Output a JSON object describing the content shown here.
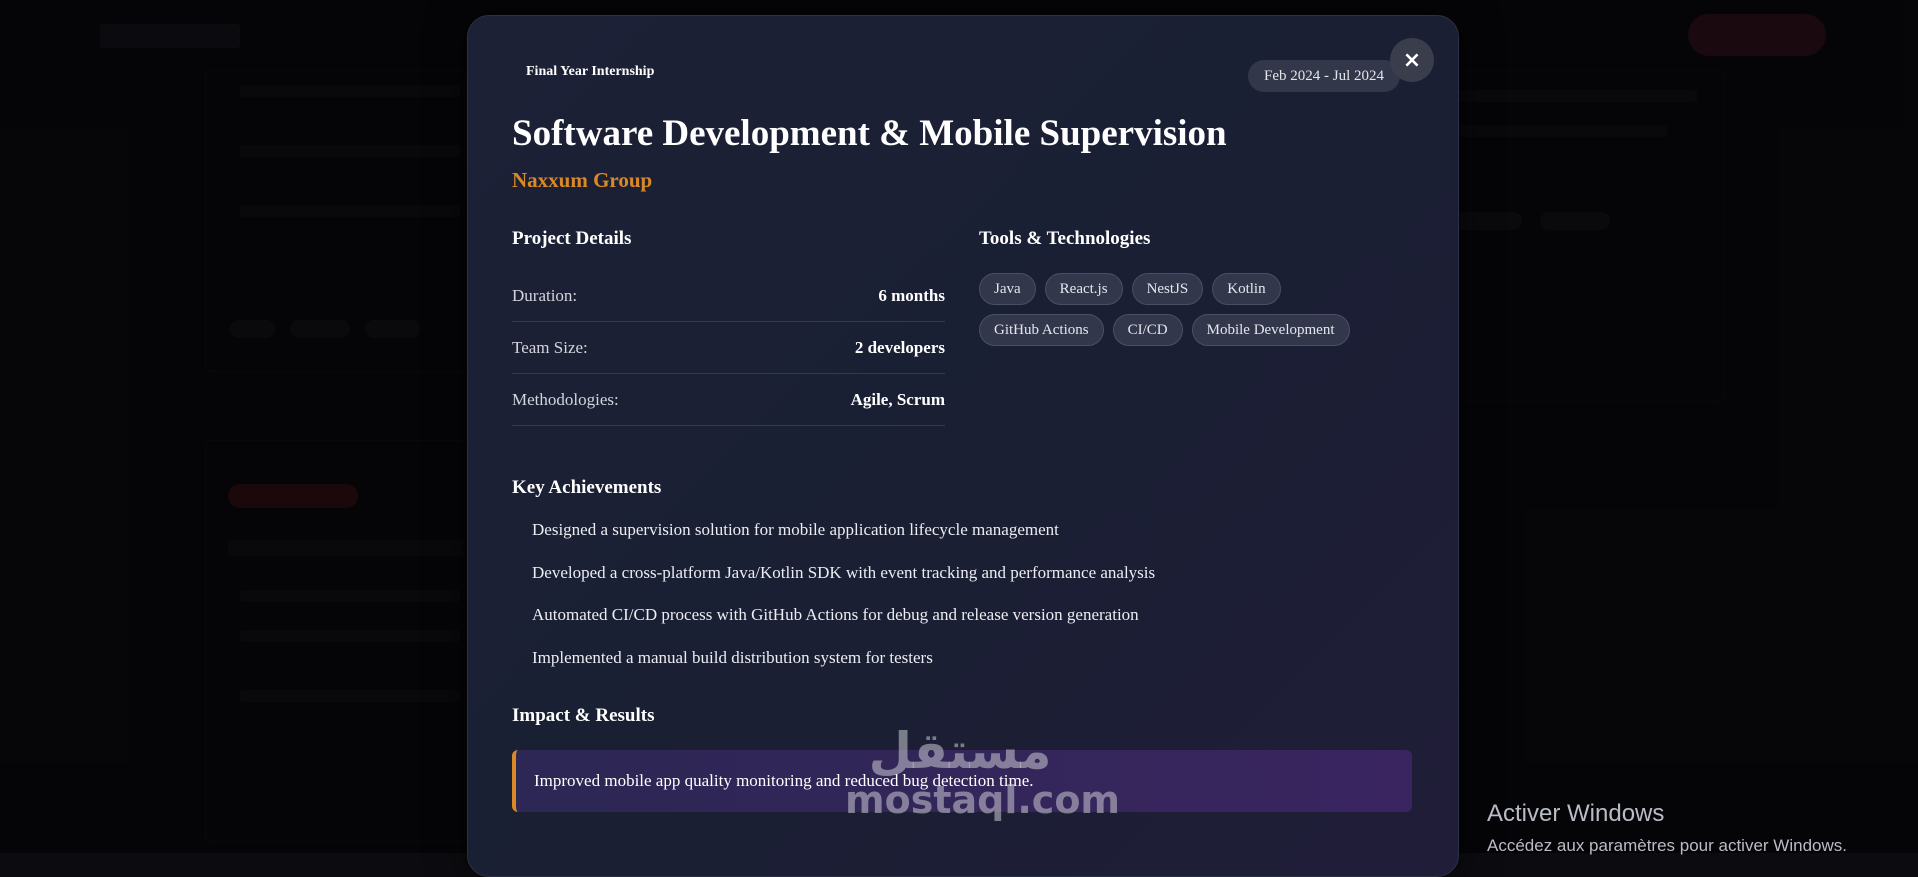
{
  "modal": {
    "subtitle": "Final Year Internship",
    "date_range": "Feb 2024 - Jul 2024",
    "close_symbol": "×",
    "title": "Software Development & Mobile Supervision",
    "company": "Naxxum Group",
    "project_details": {
      "heading": "Project Details",
      "rows": [
        {
          "label": "Duration:",
          "value": "6 months"
        },
        {
          "label": "Team Size:",
          "value": "2 developers"
        },
        {
          "label": "Methodologies:",
          "value": "Agile, Scrum"
        }
      ]
    },
    "tools": {
      "heading": "Tools & Technologies",
      "tags": [
        "Java",
        "React.js",
        "NestJS",
        "Kotlin",
        "GitHub Actions",
        "CI/CD",
        "Mobile Development"
      ]
    },
    "achievements": {
      "heading": "Key Achievements",
      "items": [
        "Designed a supervision solution for mobile application lifecycle management",
        "Developed a cross-platform Java/Kotlin SDK with event tracking and performance analysis",
        "Automated CI/CD process with GitHub Actions for debug and release version generation",
        "Implemented a manual build distribution system for testers"
      ]
    },
    "impact": {
      "heading": "Impact & Results",
      "text": "Improved mobile app quality monitoring and reduced bug detection time."
    }
  },
  "watermark": {
    "arabic": "مستقل",
    "latin": "mostaql.com"
  },
  "windows_activation": {
    "title": "Activer Windows",
    "subtitle": "Accédez aux paramètres pour activer Windows."
  },
  "colors": {
    "accent": "#d98a26",
    "modal_bg": "#1c2136",
    "impact_bg": "#2c2754"
  }
}
